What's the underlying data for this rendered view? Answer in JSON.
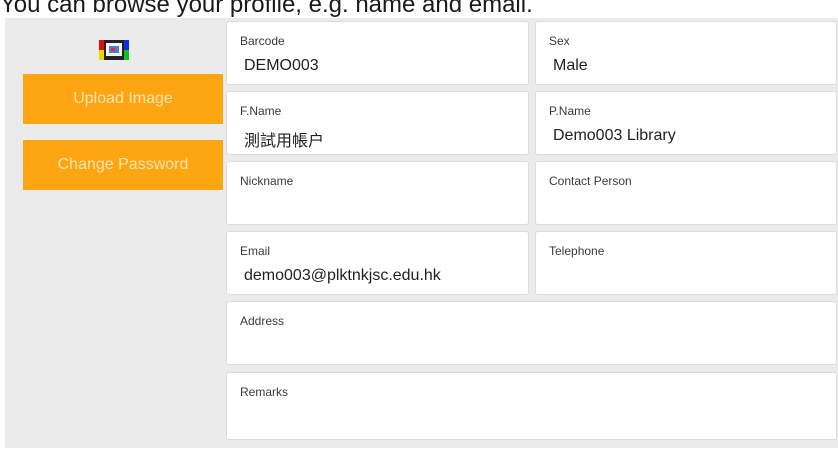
{
  "caption": "You can browse your profile, e.g. name and email.",
  "sidebar": {
    "avatar_icon": "profile-image-icon",
    "upload_label": "Upload Image",
    "change_password_label": "Change Password"
  },
  "colors": {
    "accent": "#fea512",
    "panel_background": "#ebebeb",
    "field_background": "#ffffff"
  },
  "fields": {
    "barcode": {
      "label": "Barcode",
      "value": "DEMO003"
    },
    "sex": {
      "label": "Sex",
      "value": "Male"
    },
    "fname": {
      "label": "F.Name",
      "value": "測試用帳户"
    },
    "pname": {
      "label": "P.Name",
      "value": "Demo003 Library"
    },
    "nickname": {
      "label": "Nickname",
      "value": ""
    },
    "contact": {
      "label": "Contact Person",
      "value": ""
    },
    "email": {
      "label": "Email",
      "value": "demo003@plktnkjsc.edu.hk"
    },
    "telephone": {
      "label": "Telephone",
      "value": ""
    },
    "address": {
      "label": "Address",
      "value": ""
    },
    "remarks": {
      "label": "Remarks",
      "value": ""
    }
  }
}
